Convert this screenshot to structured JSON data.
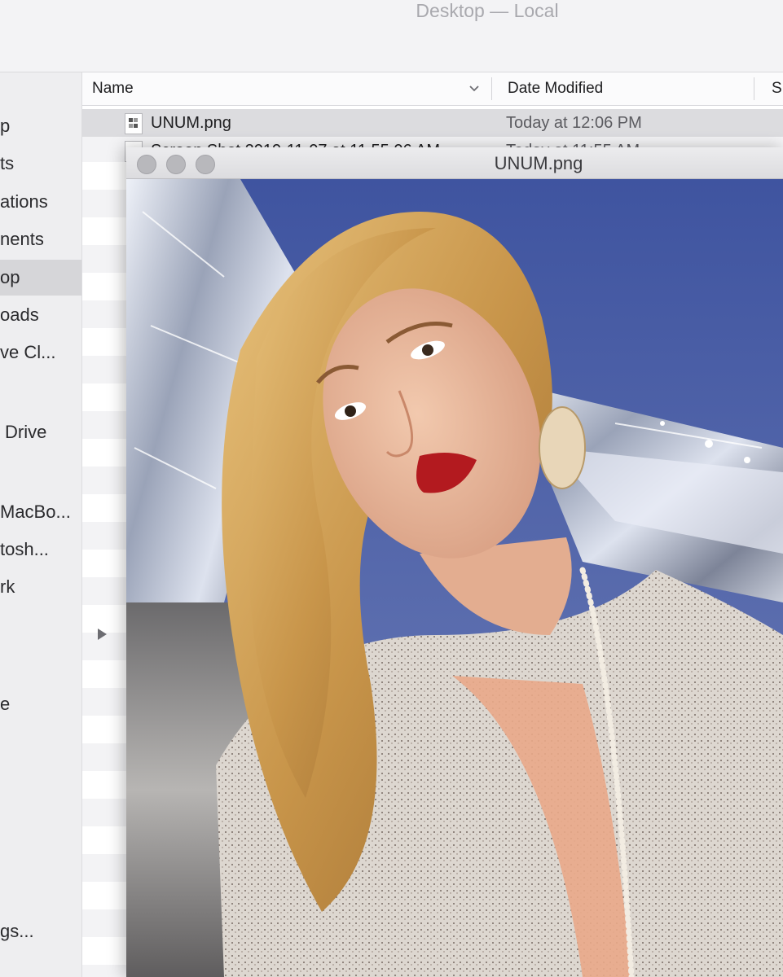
{
  "window": {
    "title": "Desktop — Local"
  },
  "sidebar": {
    "items": [
      {
        "label": "p"
      },
      {
        "label": "ts"
      },
      {
        "label": "ations"
      },
      {
        "label": "nents"
      },
      {
        "label": "op"
      },
      {
        "label": "oads"
      },
      {
        "label": "ve Cl..."
      },
      {
        "label": "Drive"
      },
      {
        "label": "MacBo..."
      },
      {
        "label": "tosh..."
      },
      {
        "label": "rk"
      },
      {
        "label": "e"
      },
      {
        "label": "gs..."
      }
    ]
  },
  "columns": {
    "name": "Name",
    "date_modified": "Date Modified",
    "size": "S"
  },
  "files": [
    {
      "name": "UNUM.png",
      "date": "Today at 12:06 PM"
    },
    {
      "name": "Screen Shot 2019-11-07 at 11.55.06 AM",
      "date": "Today at 11:55 AM"
    }
  ],
  "preview": {
    "title": "UNUM.png"
  },
  "colors": {
    "sky": "#5b6fae",
    "foil": "#c9cdd8",
    "hair": "#c8954a",
    "lips": "#b31a1f",
    "jacket": "#dcd6cf"
  }
}
